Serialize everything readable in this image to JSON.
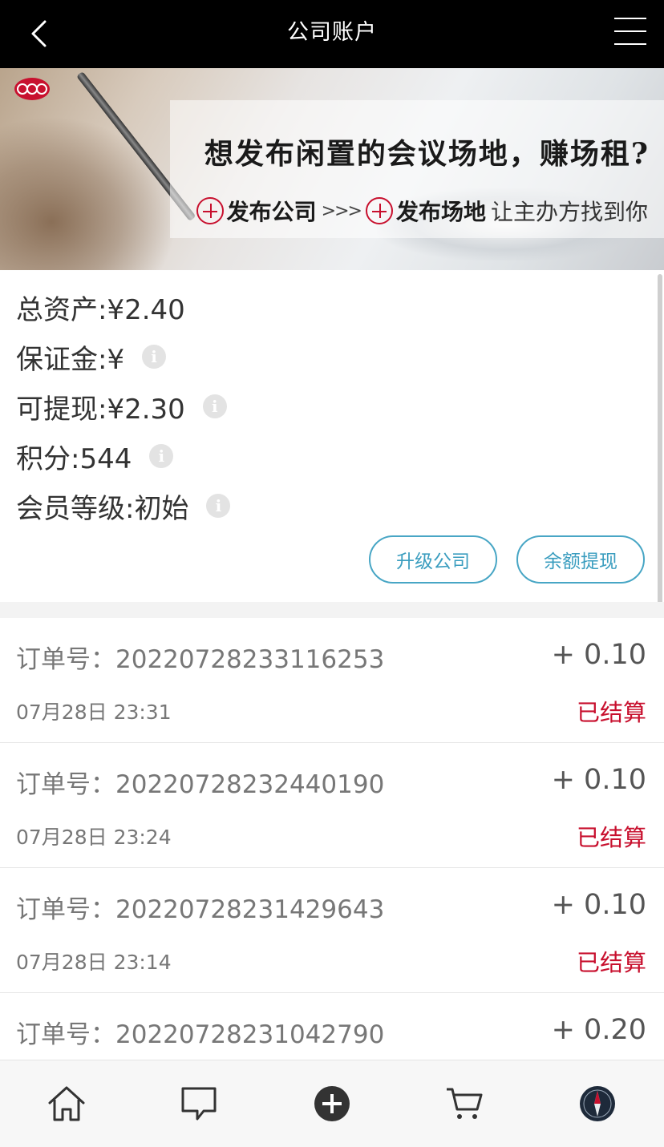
{
  "header": {
    "title": "公司账户",
    "back_icon": "chevron-left-icon",
    "menu_icon": "hamburger-menu-icon"
  },
  "banner": {
    "headline": "想发布闲置的会议场地，赚场租?",
    "step1": "发布公司",
    "arrows": ">>>",
    "step2": "发布场地",
    "tail": "让主办方找到你"
  },
  "account": {
    "total_assets": "总资产:¥2.40",
    "deposit": "保证金:¥",
    "withdrawable": "可提现:¥2.30",
    "points": "积分:544",
    "member_level": "会员等级:初始",
    "upgrade_button": "升级公司",
    "withdraw_button": "余额提现"
  },
  "orders": [
    {
      "order_no": "订单号：20220728233116253",
      "amount": "+ 0.10",
      "time": "07月28日 23:31",
      "status": "已结算"
    },
    {
      "order_no": "订单号：20220728232440190",
      "amount": "+ 0.10",
      "time": "07月28日 23:24",
      "status": "已结算"
    },
    {
      "order_no": "订单号：20220728231429643",
      "amount": "+ 0.10",
      "time": "07月28日 23:14",
      "status": "已结算"
    },
    {
      "order_no": "订单号：20220728231042790",
      "amount": "+ 0.20",
      "time": "",
      "status": ""
    }
  ],
  "bottom_nav": {
    "items": [
      "home-icon",
      "message-icon",
      "add-circle-icon",
      "cart-icon",
      "compass-avatar-icon"
    ]
  },
  "colors": {
    "header_bg": "#000000",
    "accent_red": "#c8102e",
    "button_blue": "#48a6c5"
  }
}
